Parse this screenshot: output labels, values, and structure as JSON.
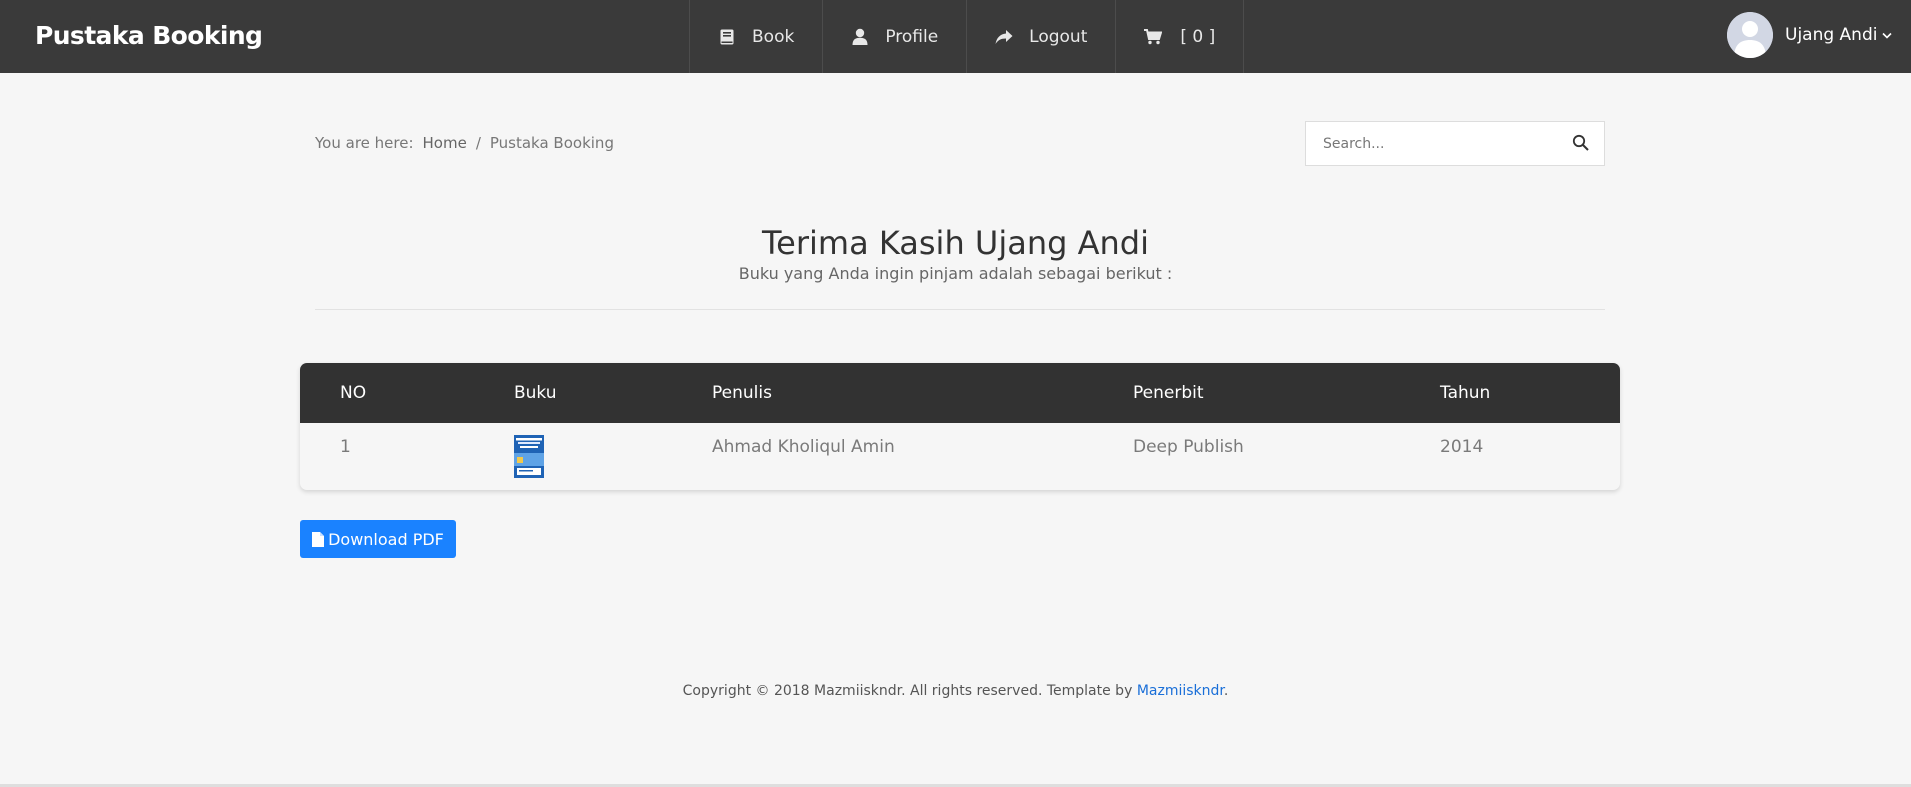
{
  "brand": "Pustaka Booking",
  "nav": {
    "book": "Book",
    "profile": "Profile",
    "logout": "Logout",
    "cart": "[ 0 ]"
  },
  "user": {
    "name": "Ujang Andi"
  },
  "breadcrumb": {
    "prefix": "You are here:",
    "home": "Home",
    "separator": "/",
    "current": "Pustaka Booking"
  },
  "search": {
    "placeholder": "Search..."
  },
  "heading": "Terima Kasih Ujang Andi",
  "subheading": "Buku yang Anda ingin pinjam adalah sebagai berikut :",
  "table": {
    "headers": [
      "NO",
      "Buku",
      "Penulis",
      "Penerbit",
      "Tahun"
    ],
    "rows": [
      {
        "no": "1",
        "penulis": "Ahmad Kholiqul Amin",
        "penerbit": "Deep Publish",
        "tahun": "2014"
      }
    ]
  },
  "download_label": "Download PDF",
  "footer": {
    "text": "Copyright © 2018 Mazmiiskndr. All rights reserved. Template by ",
    "link": "Mazmiiskndr",
    "end": "."
  },
  "colors": {
    "topbar": "#3a3a3a",
    "table_header": "#323232",
    "button": "#1a82ff",
    "link": "#1a6fd8"
  },
  "icons": [
    "book-icon",
    "user-icon",
    "share-icon",
    "cart-icon",
    "chevron-down-icon",
    "search-icon",
    "file-icon"
  ]
}
